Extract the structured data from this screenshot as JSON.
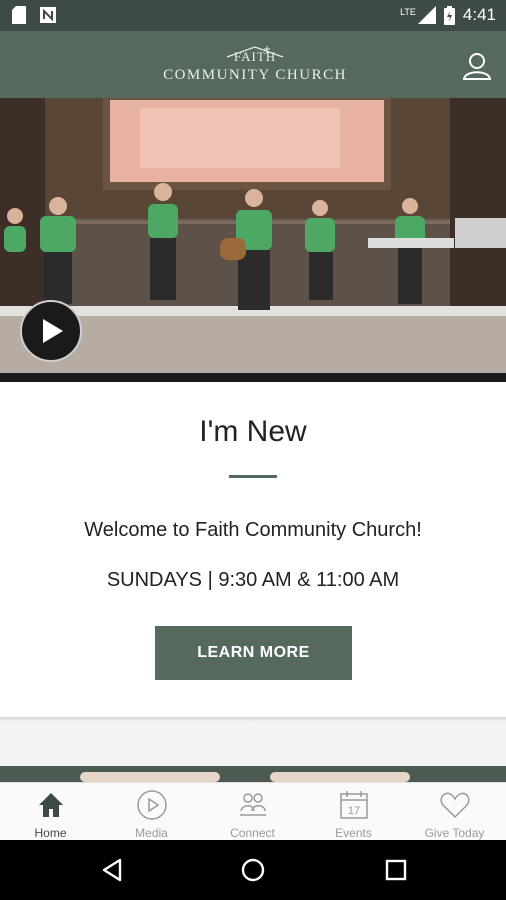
{
  "status_bar": {
    "time": "4:41",
    "network": "LTE",
    "icons": [
      "sd-card-icon",
      "n-notification-icon",
      "signal-icon",
      "battery-icon"
    ]
  },
  "header": {
    "logo_top": "FAITH",
    "logo_bottom": "COMMUNITY CHURCH",
    "profile_icon": "profile-icon"
  },
  "hero": {
    "play_icon": "play-icon"
  },
  "card": {
    "title": "I'm New",
    "welcome": "Welcome to Faith Community Church!",
    "times": "SUNDAYS | 9:30 AM & 11:00 AM",
    "button": "LEARN MORE"
  },
  "bottom_nav": {
    "items": [
      {
        "label": "Home",
        "icon": "home-icon",
        "active": true
      },
      {
        "label": "Media",
        "icon": "play-circle-icon",
        "active": false
      },
      {
        "label": "Connect",
        "icon": "connect-icon",
        "active": false
      },
      {
        "label": "Events",
        "icon": "calendar-icon",
        "active": false
      },
      {
        "label": "Give Today",
        "icon": "heart-icon",
        "active": false
      }
    ],
    "calendar_day": "17"
  },
  "colors": {
    "accent": "#55695d",
    "status_bar": "#3e4a44"
  }
}
